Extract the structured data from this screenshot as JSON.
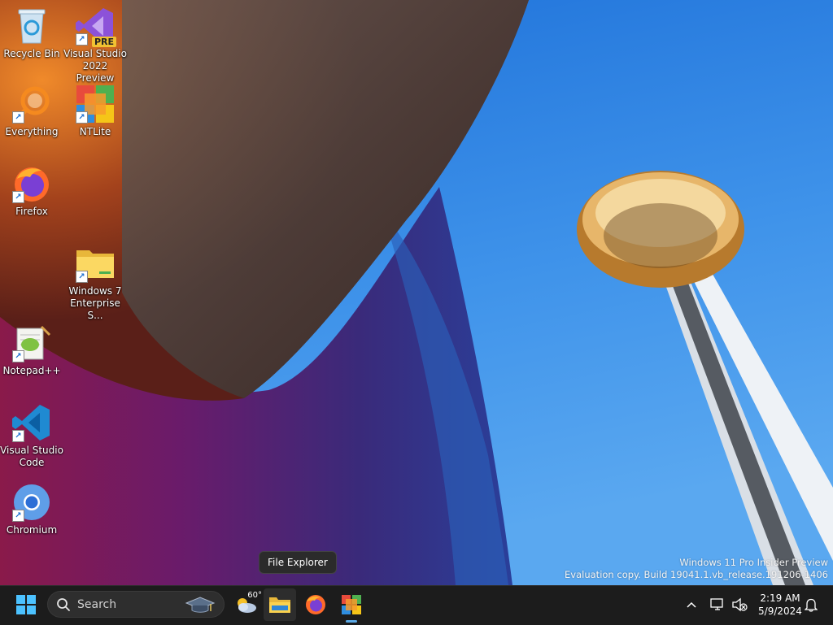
{
  "desktop": {
    "icons": [
      {
        "label": "Recycle Bin",
        "icon": "recycle-bin-icon"
      },
      {
        "label": "Visual Studio\n2022 Preview",
        "icon": "visual-studio-preview-icon",
        "badge": "PRE"
      },
      {
        "label": "Everything",
        "icon": "everything-search-icon"
      },
      {
        "label": "NTLite",
        "icon": "ntlite-icon"
      },
      {
        "label": "Firefox",
        "icon": "firefox-icon"
      },
      {
        "label": "Windows 7\nEnterprise S...",
        "icon": "folder-icon"
      },
      {
        "label": "Notepad++",
        "icon": "notepad-plus-plus-icon"
      },
      {
        "label": "Visual Studio\nCode",
        "icon": "vscode-icon"
      },
      {
        "label": "Chromium",
        "icon": "chromium-icon"
      }
    ],
    "watermark": {
      "line1": "Windows 11 Pro Insider Preview",
      "line2": "Evaluation copy. Build 19041.1.vb_release.191206-1406"
    },
    "tooltip": "File Explorer"
  },
  "taskbar": {
    "search_label": "Search",
    "weather_temp": "60°",
    "clock_time": "2:19 AM",
    "clock_date": "5/9/2024",
    "accent": "#5aa9e6",
    "start_color": "#4cc2ff"
  }
}
